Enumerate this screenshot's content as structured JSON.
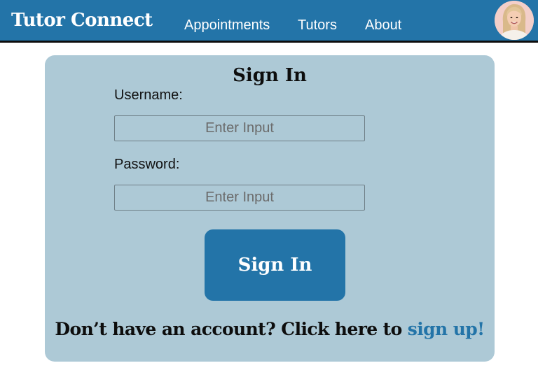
{
  "header": {
    "brand": "Tutor Connect",
    "nav": {
      "appointments": "Appointments",
      "tutors": "Tutors",
      "about": "About"
    },
    "avatar_icon": "user-avatar-photo"
  },
  "signin": {
    "title": "Sign In",
    "username_label": "Username:",
    "username_placeholder": "Enter Input",
    "username_value": "",
    "password_label": "Password:",
    "password_placeholder": "Enter Input",
    "password_value": "",
    "button_label": "Sign In",
    "signup_prompt": "Don’t have an account? Click here to ",
    "signup_link": "sign up!"
  },
  "colors": {
    "primary": "#2374a8",
    "card_background": "#adc9d6",
    "text_dark": "#0d0d0d",
    "white": "#ffffff"
  }
}
